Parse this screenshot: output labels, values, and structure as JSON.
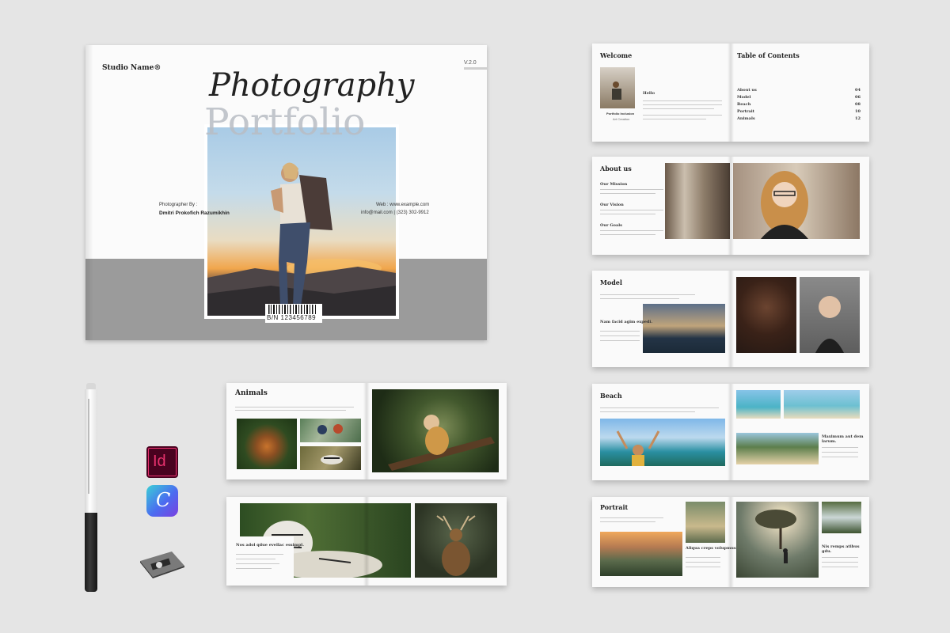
{
  "cover": {
    "studio": "Studio Name®",
    "version": "V.2.0",
    "title_script": "Photography",
    "title_big": "Portfolio",
    "photographer_label": "Photographer By :",
    "photographer_name": "Dmitri Prokofich Razumikhin",
    "web": "Web : www.example.com",
    "contact": "info@mail.com | (323) 302-9912",
    "barcode": "B/N 123456789"
  },
  "welcome": {
    "title": "Welcome",
    "hello": "Hello",
    "caption_name": "Portfolio Inclusion",
    "caption_sub": "Art Creation"
  },
  "toc": {
    "title": "Table of Contents",
    "items": [
      {
        "label": "About us",
        "page": "04"
      },
      {
        "label": "Model",
        "page": "06"
      },
      {
        "label": "Beach",
        "page": "08"
      },
      {
        "label": "Portrait",
        "page": "10"
      },
      {
        "label": "Animals",
        "page": "12"
      }
    ]
  },
  "about": {
    "title": "About us",
    "s1": "Our Mission",
    "s2": "Our Vision",
    "s3": "Our Goals"
  },
  "model": {
    "title": "Model",
    "heading": "Nam facid agim expedi."
  },
  "beach": {
    "title": "Beach",
    "heading": "Maximum aut dem larum."
  },
  "portrait": {
    "title": "Portrait",
    "heading": "Aliqua creps volupmus.",
    "heading2": "Nis remps atibus gdu."
  },
  "animals": {
    "title": "Animals"
  },
  "animals2": {
    "heading": "Nos adol qdue evellac essimpl."
  },
  "icons": {
    "indesign": "Id",
    "canva": "C"
  },
  "colors": {
    "background": "#e5e5e5",
    "cover_band": "#9b9b9b",
    "indesign": "#e8326e",
    "canva": "#4b6cf0"
  }
}
